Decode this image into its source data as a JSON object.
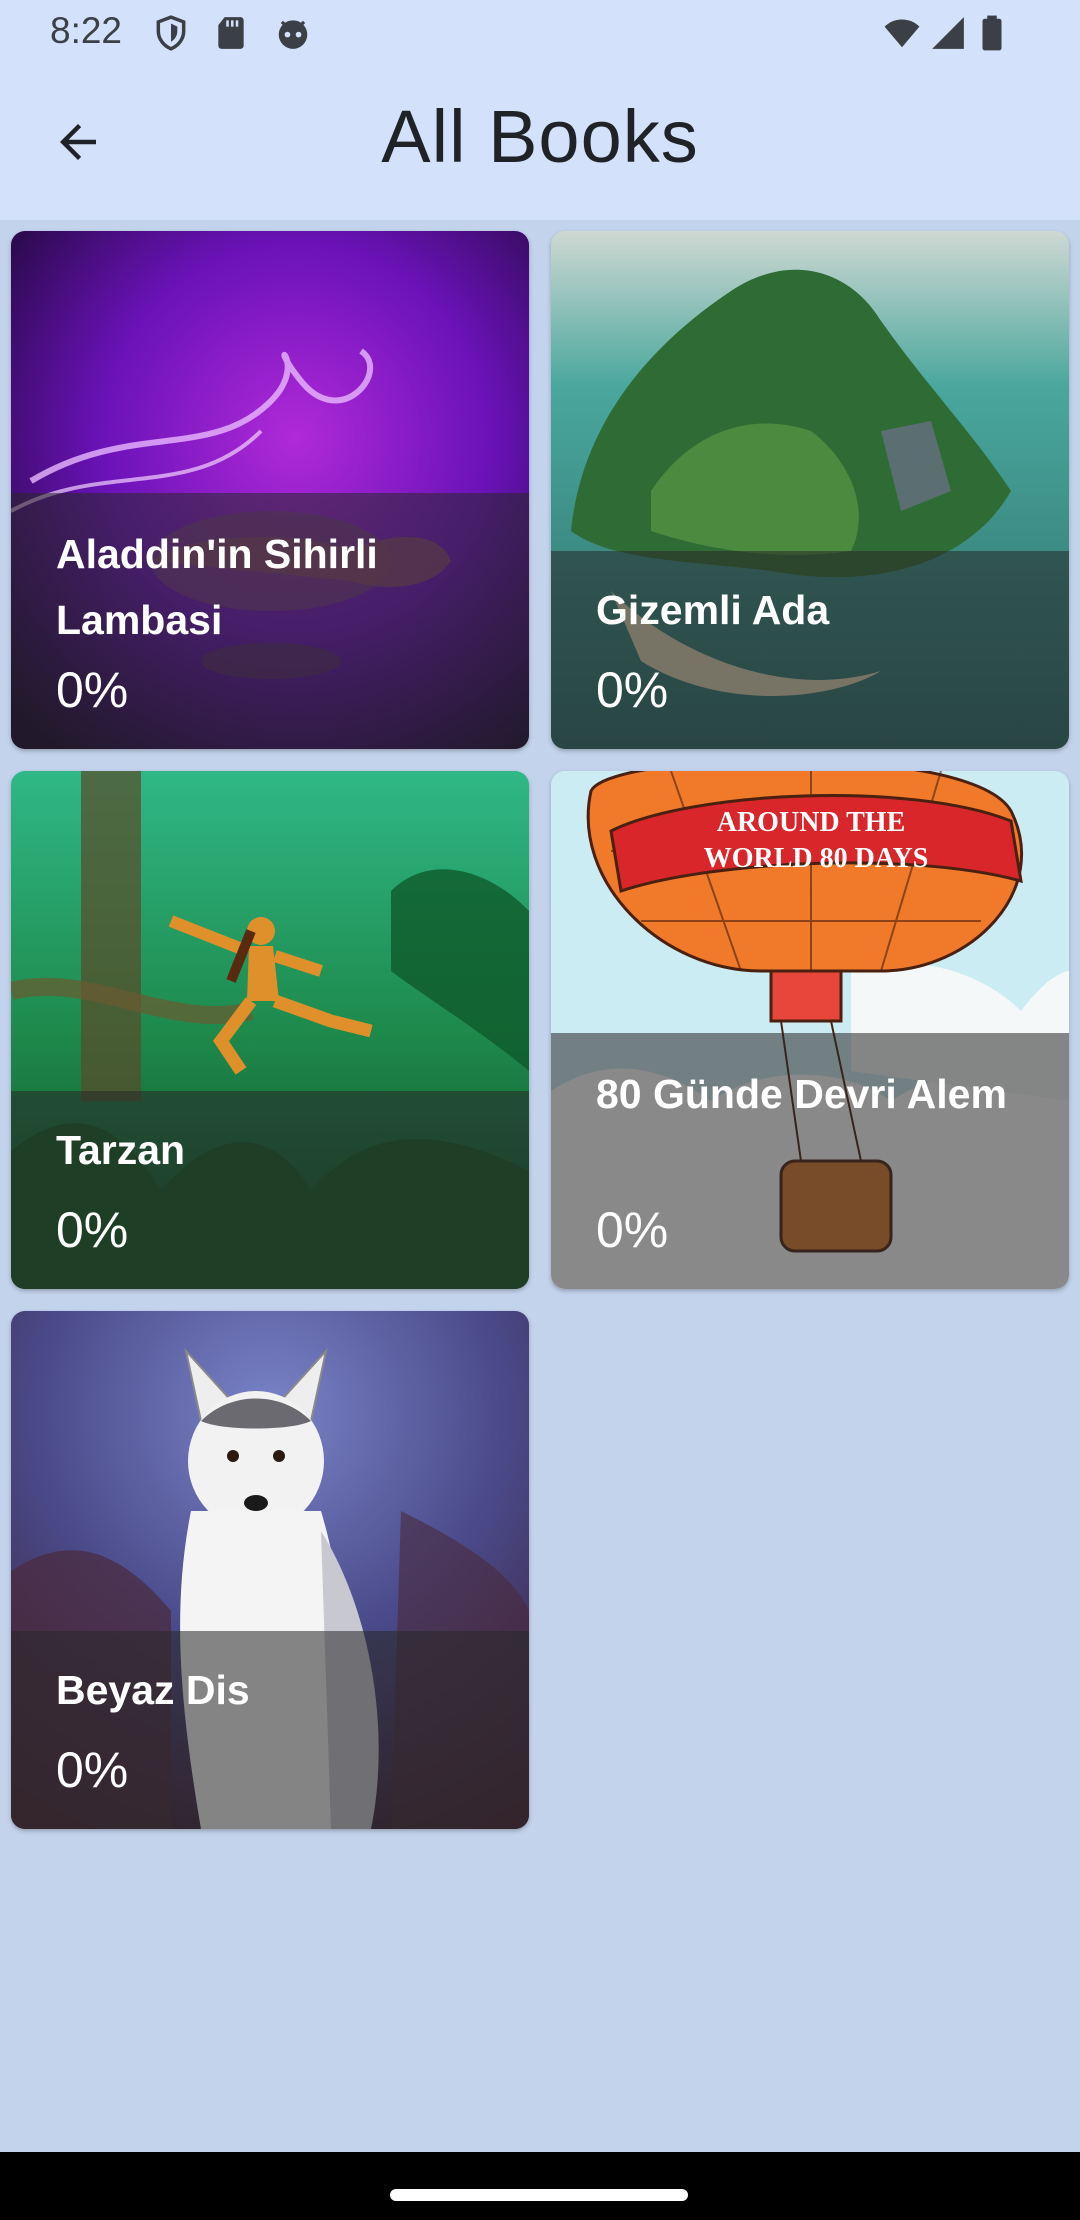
{
  "status_bar": {
    "time": "8:22",
    "left_icons": [
      "shield-icon",
      "sd-card-icon",
      "android-debug-icon"
    ],
    "right_icons": [
      "wifi-icon",
      "cellular-signal-icon",
      "battery-icon"
    ]
  },
  "app_bar": {
    "back_icon": "arrow-left-icon",
    "title": "All Books"
  },
  "books": [
    {
      "title": "Aladdin'in Sihirli Lambasi",
      "progress": "0%",
      "cover": "magic-lamp-cover"
    },
    {
      "title": "Gizemli Ada",
      "progress": "0%",
      "cover": "mysterious-island-cover"
    },
    {
      "title": "Tarzan",
      "progress": "0%",
      "cover": "jungle-tarzan-cover"
    },
    {
      "title": "80 Günde Devri Alem",
      "progress": "0%",
      "cover": "hot-air-balloon-cover",
      "cover_text_line1": "AROUND THE",
      "cover_text_line2": "WORLD 80 DAYS"
    },
    {
      "title": "Beyaz Dis",
      "progress": "0%",
      "cover": "white-wolf-cover"
    }
  ],
  "colors": {
    "background": "#c3d3ec",
    "app_bar": "#d3e1fa",
    "title_text": "#1f2328"
  }
}
